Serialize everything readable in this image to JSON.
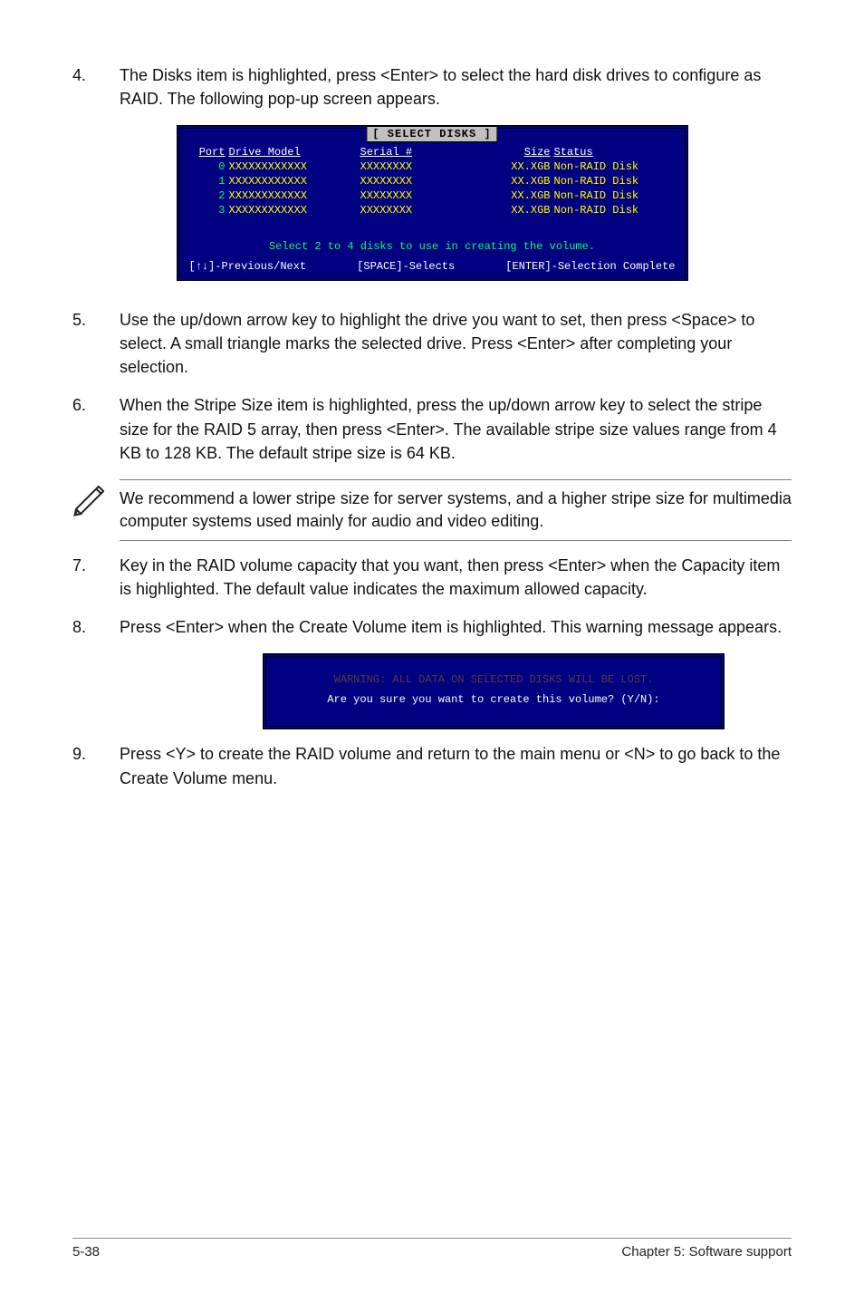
{
  "steps": {
    "s4": {
      "num": "4.",
      "text": "The Disks item is highlighted, press <Enter> to select the hard disk drives to configure as RAID. The following pop-up screen appears."
    },
    "s5": {
      "num": "5.",
      "text": "Use the up/down arrow key to highlight the drive you want to set, then press <Space> to select. A small triangle marks the selected drive. Press <Enter> after completing your selection."
    },
    "s6": {
      "num": "6.",
      "text": "When the Stripe Size item is highlighted, press the up/down arrow key to select the stripe size for the RAID 5 array, then press <Enter>. The available stripe size values range from 4 KB to 128 KB. The default stripe size is 64 KB."
    },
    "s7": {
      "num": "7.",
      "text": "Key in the RAID volume capacity that you want, then press <Enter> when the Capacity item is highlighted. The default value indicates the maximum allowed capacity."
    },
    "s8": {
      "num": "8.",
      "text": "Press <Enter> when the Create Volume item is highlighted. This warning message appears."
    },
    "s9": {
      "num": "9.",
      "text": "Press <Y> to create the RAID volume and return to the main menu or <N> to go back to the Create Volume menu."
    }
  },
  "note": {
    "text": "We recommend a lower stripe size for server systems, and a higher stripe size for multimedia computer systems used mainly for audio and video editing."
  },
  "term1": {
    "title": "[ SELECT DISKS ]",
    "headers": {
      "port": "Port",
      "model": "Drive Model",
      "serial": "Serial #",
      "size": "Size",
      "status": "Status"
    },
    "rows": [
      {
        "port": "0",
        "model": "XXXXXXXXXXXX",
        "serial": "XXXXXXXX",
        "size": "XX.XGB",
        "status": "Non-RAID Disk"
      },
      {
        "port": "1",
        "model": "XXXXXXXXXXXX",
        "serial": "XXXXXXXX",
        "size": "XX.XGB",
        "status": "Non-RAID Disk"
      },
      {
        "port": "2",
        "model": "XXXXXXXXXXXX",
        "serial": "XXXXXXXX",
        "size": "XX.XGB",
        "status": "Non-RAID Disk"
      },
      {
        "port": "3",
        "model": "XXXXXXXXXXXX",
        "serial": "XXXXXXXX",
        "size": "XX.XGB",
        "status": "Non-RAID Disk"
      }
    ],
    "hint": "Select 2 to 4 disks to use in creating the volume.",
    "footer": {
      "left": "[↑↓]-Previous/Next",
      "mid": "[SPACE]-Selects",
      "right": "[ENTER]-Selection Complete"
    }
  },
  "term2": {
    "line1": "WARNING: ALL DATA ON SELECTED DISKS WILL BE LOST.",
    "line2": "Are you sure you want to create this volume? (Y/N):"
  },
  "footer": {
    "left": "5-38",
    "right": "Chapter 5: Software support"
  }
}
